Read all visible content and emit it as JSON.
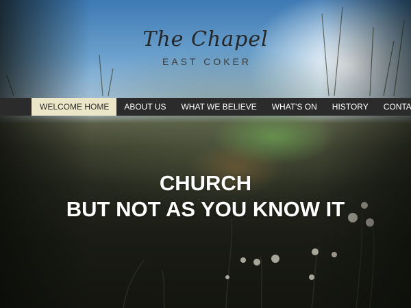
{
  "logo": {
    "title": "The Chapel",
    "subtitle": "EAST COKER"
  },
  "nav": {
    "items": [
      {
        "label": "WELCOME HOME",
        "active": true
      },
      {
        "label": "ABOUT US",
        "active": false
      },
      {
        "label": "WHAT WE BELIEVE",
        "active": false
      },
      {
        "label": "WHAT'S ON",
        "active": false
      },
      {
        "label": "HISTORY",
        "active": false
      },
      {
        "label": "CONTACT",
        "active": false
      }
    ]
  },
  "hero": {
    "line1": "CHURCH",
    "line2": "BUT NOT AS YOU KNOW IT"
  },
  "colors": {
    "nav_background": "#2b2b2b",
    "nav_active_background": "#ece6c8",
    "nav_text": "#ffffff",
    "hero_text": "#ffffff"
  }
}
